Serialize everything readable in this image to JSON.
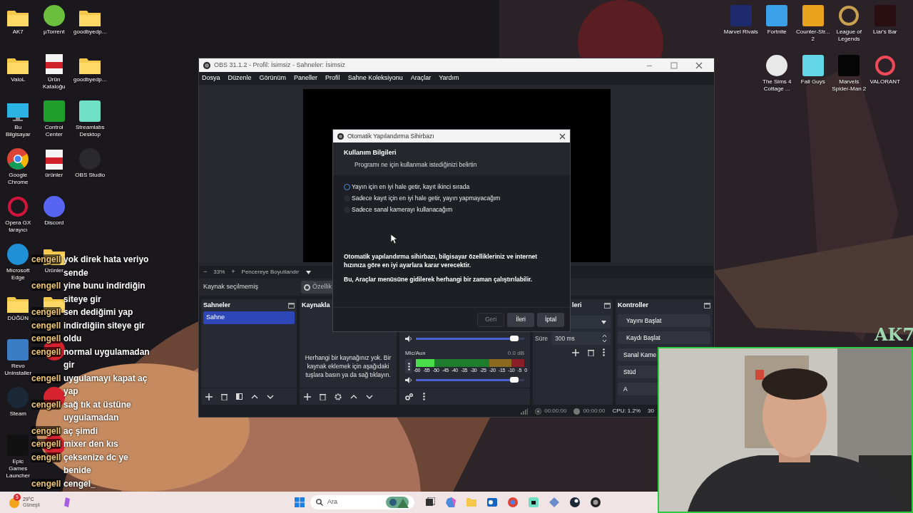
{
  "desktop_icons_left": [
    [
      {
        "label": "AK7",
        "kind": "folder"
      },
      {
        "label": "µTorrent",
        "kind": "circle",
        "color": "#6cbf3c"
      },
      {
        "label": "goodbyedp...",
        "kind": "folder"
      }
    ],
    [
      {
        "label": "ValoL",
        "kind": "folder"
      },
      {
        "label": "Ürün Kataloğu",
        "kind": "pdf"
      },
      {
        "label": "goodbyedp...",
        "kind": "folder"
      }
    ],
    [
      {
        "label": "Bu Bilgisayar",
        "kind": "monitor"
      },
      {
        "label": "Control Center",
        "kind": "tile",
        "color": "#1f9e2c"
      },
      {
        "label": "Streamlabs Desktop",
        "kind": "tile",
        "color": "#6fe0c4"
      }
    ],
    [
      {
        "label": "Google Chrome",
        "kind": "chrome"
      },
      {
        "label": "ürünler",
        "kind": "pdf"
      },
      {
        "label": "OBS Studio",
        "kind": "circle",
        "color": "#2a2a2e"
      }
    ],
    [
      {
        "label": "Opera GX tarayıcı",
        "kind": "ring",
        "color": "#d0143c"
      },
      {
        "label": "Discord",
        "kind": "circle",
        "color": "#5865f2"
      }
    ],
    [
      {
        "label": "Microsoft Edge",
        "kind": "circle",
        "color": "#1f8fd6"
      },
      {
        "label": "Ürünler",
        "kind": "folder"
      }
    ],
    [
      {
        "label": "DÜĞÜN",
        "kind": "folder"
      },
      {
        "kind": "folder"
      }
    ],
    [
      {
        "label": "Revo Uninstaller",
        "kind": "tile",
        "color": "#3b7dc4"
      },
      {
        "kind": "circle",
        "color": "#d7232f"
      }
    ],
    [
      {
        "label": "Steam",
        "kind": "circle",
        "color": "#1b2838"
      },
      {
        "kind": "circle",
        "color": "#d7232f"
      }
    ],
    [
      {
        "label": "Epic Games Launcher",
        "kind": "tile",
        "color": "#111111"
      },
      {
        "kind": "circle",
        "color": "#d7232f"
      }
    ]
  ],
  "desktop_icons_right": [
    [
      {
        "label": "Marvel Rivals",
        "kind": "tile",
        "color": "#1d2a6b"
      },
      {
        "label": "Fortnite",
        "kind": "tile",
        "color": "#3aa0e8"
      },
      {
        "label": "Counter-Str... 2",
        "kind": "tile",
        "color": "#e9a21d"
      },
      {
        "label": "League of Legends",
        "kind": "ring",
        "color": "#c8a050"
      },
      {
        "label": "Liar's Bar",
        "kind": "tile",
        "color": "#2a0f12"
      }
    ],
    [
      {
        "label": "The Sims 4 Cottage ...",
        "kind": "circle",
        "color": "#e8e8e8"
      },
      {
        "label": "Fall Guys",
        "kind": "tile",
        "color": "#63d7e8"
      },
      {
        "label": "Marvels Spider-Man 2",
        "kind": "tile",
        "color": "#050505"
      },
      {
        "label": "VALORANT",
        "kind": "ring",
        "color": "#f04a5a"
      }
    ]
  ],
  "obs_window": {
    "title": "OBS 31.1.2 - Profil: İsimsiz - Sahneler: İsimsiz",
    "menu": [
      "Dosya",
      "Düzenle",
      "Görünüm",
      "Paneller",
      "Profil",
      "Sahne Koleksiyonu",
      "Araçlar",
      "Yardım"
    ],
    "zoom_bar": {
      "zoom_out": "−",
      "zoom": "33%",
      "zoom_in": "+",
      "fit": "Pencereye Boyutlandır"
    },
    "source_bar": {
      "status": "Kaynak seçilmemiş",
      "properties": "Özellik"
    },
    "scenes": {
      "title": "Sahneler",
      "items": [
        {
          "label": "Sahne",
          "selected": true
        }
      ]
    },
    "sources": {
      "title": "Kaynakla",
      "empty_text": "Herhangi bir kaynağınız yok. Bir kaynak eklemek için aşağıdaki tuşlara basın ya da sağ tıklayın."
    },
    "audio_mixer": {
      "channels": [
        {
          "level": 0.95
        },
        {
          "name": "Mic/Aux",
          "reading": "0.0 dB",
          "meter": {
            "level": 0.17
          },
          "level": 0.95
        }
      ],
      "meter_scale": [
        "-60",
        "-55",
        "-50",
        "-45",
        "-40",
        "-35",
        "-30",
        "-25",
        "-20",
        "-15",
        "-10",
        "-5",
        "0"
      ]
    },
    "transitions": {
      "title": "leri",
      "duration_label": "Süre",
      "duration": "300 ms"
    },
    "controls": {
      "title": "Kontroller",
      "buttons": [
        "Yayını Başlat",
        "Kaydı Başlat",
        "Sanal Kame",
        "Stüd",
        "A"
      ]
    },
    "status_bar": {
      "times": [
        "00:00:00",
        "00:00:00"
      ],
      "cpu": "CPU: 1.2%",
      "fps": "30"
    }
  },
  "dialog": {
    "title": "Otomatik Yapılandırma Sihirbazı",
    "heading": "Kullanım Bilgileri",
    "subheading": "Programı ne için kullanmak istediğinizi belirtin",
    "options": [
      {
        "label": "Yayın için en iyi hale getir, kayıt ikinci sırada",
        "selected": true
      },
      {
        "label": "Sadece kayıt için en iyi hale getir, yayın yapmayacağım",
        "selected": false
      },
      {
        "label": "Sadece sanal kamerayı kullanacağım",
        "selected": false
      }
    ],
    "description": [
      "Otomatik yapılandırma sihirbazı, bilgisayar özellikleriniz ve internet hızınıza göre en iyi ayarlara karar verecektir.",
      "Bu, Araçlar menüsüne gidilerek herhangi bir zaman çalıştırılabilir."
    ],
    "buttons": [
      {
        "label": "Geri",
        "disabled": true
      },
      {
        "label": "İleri",
        "disabled": false
      },
      {
        "label": "İptal",
        "disabled": false
      }
    ]
  },
  "chat": [
    {
      "user": "cengell",
      "message": "yok direk hata veriyo sende"
    },
    {
      "user": "cengell",
      "message": "yine bunu indirdiğin siteye gir"
    },
    {
      "user": "cengell",
      "message": "sen dediğimi yap"
    },
    {
      "user": "cengell",
      "message": "indirdiğiin siteye gir"
    },
    {
      "user": "cengell",
      "message": "oldu"
    },
    {
      "user": "cengell",
      "message": "normal uygulamadan gir"
    },
    {
      "user": "cengell",
      "message": "uygulamayı kapat aç yap"
    },
    {
      "user": "cengell",
      "message": "sağ tık at üstüne uygulamadan"
    },
    {
      "user": "cengell",
      "message": "aç şimdi"
    },
    {
      "user": "cengell",
      "message": "mixer den kıs"
    },
    {
      "user": "cengell",
      "message": "çeksenize dc ye benide"
    },
    {
      "user": "cengell",
      "message": "cengel_"
    }
  ],
  "brand_overlay": "AK7",
  "taskbar": {
    "weather": {
      "badge": "5",
      "temp": "29°C",
      "condition": "Güneşli"
    },
    "search_placeholder": "Ara"
  }
}
